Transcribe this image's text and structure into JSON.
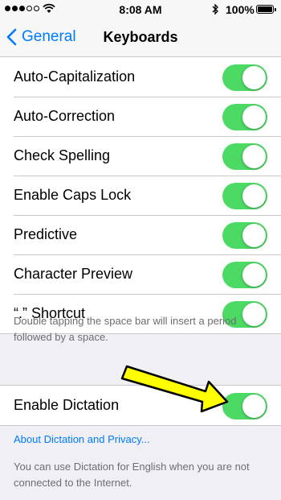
{
  "status_bar": {
    "time": "8:08 AM",
    "battery_percent": "100%",
    "signal_bars_filled": 3,
    "signal_bars_total": 5,
    "icons": [
      "signal-dots-icon",
      "wifi-icon",
      "bluetooth-icon",
      "battery-icon"
    ]
  },
  "nav": {
    "back_label": "General",
    "title": "Keyboards",
    "accent_color": "#007aff"
  },
  "settings": [
    {
      "label": "Auto-Capitalization",
      "on": true
    },
    {
      "label": "Auto-Correction",
      "on": true
    },
    {
      "label": "Check Spelling",
      "on": true
    },
    {
      "label": "Enable Caps Lock",
      "on": true
    },
    {
      "label": "Predictive",
      "on": true
    },
    {
      "label": "Character Preview",
      "on": true
    },
    {
      "label": "“.” Shortcut",
      "on": true
    }
  ],
  "shortcut_footer": "Double tapping the space bar will insert a period followed by a space.",
  "dictation": {
    "label": "Enable Dictation",
    "on": true,
    "link": "About Dictation and Privacy...",
    "footer": "You can use Dictation for English when you are not connected to the Internet."
  },
  "colors": {
    "toggle_on": "#4cd964",
    "background": "#efeff4",
    "annotation_arrow": "#ffff00"
  }
}
